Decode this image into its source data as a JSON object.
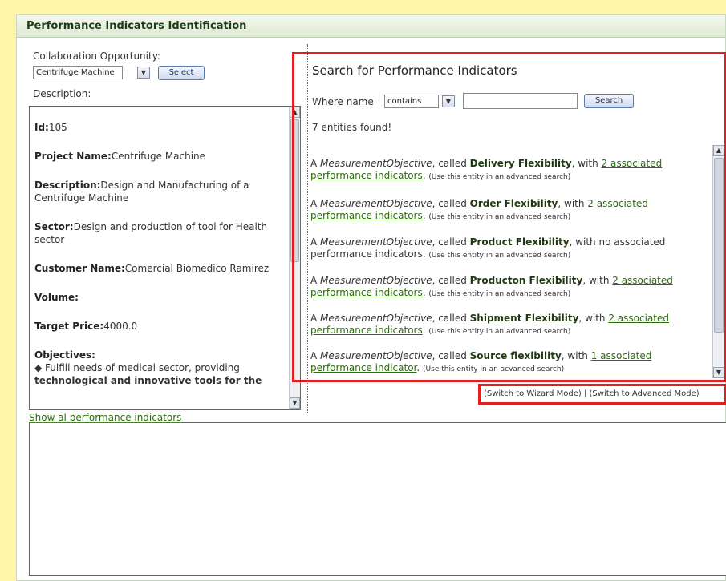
{
  "panel": {
    "title": "Performance Indicators Identification"
  },
  "left": {
    "collab_label": "Collaboration Opportunity:",
    "collab_value": "Centrifuge Machine",
    "select_button": "Select",
    "description_label": "Description:"
  },
  "description": {
    "id_label": "Id:",
    "id_value": "105",
    "project_label": "Project Name:",
    "project_value": "Centrifuge Machine",
    "desc_label": "Description:",
    "desc_value": "Design and Manufacturing of a Centrifuge Machine",
    "sector_label": "Sector:",
    "sector_value": "Design and production of tool for Health sector",
    "customer_label": "Customer Name:",
    "customer_value": "Comercial Biomedico Ramirez",
    "volume_label": "Volume:",
    "price_label": "Target Price:",
    "price_value": "4000.0",
    "objectives_label": "Objectives:",
    "objective_1": "Fulfill needs of medical sector, providing",
    "objective_2": "technological and innovative tools for the"
  },
  "search": {
    "title": "Search for Performance Indicators",
    "where_label": "Where name",
    "operator": "contains",
    "query": "",
    "button": "Search",
    "count_text": "7 entities found!"
  },
  "results": [
    {
      "prefix": "A ",
      "type": "MeasurementObjective",
      "called": ", called ",
      "name": "Delivery Flexibility",
      "mid": ", with ",
      "link": "2 associated performance indicators",
      "end": ". ",
      "hint": "(Use this entity in an advanced search)"
    },
    {
      "prefix": "A ",
      "type": "MeasurementObjective",
      "called": ", called ",
      "name": "Order Flexibility",
      "mid": ", with ",
      "link": "2 associated performance indicators",
      "end": ". ",
      "hint": "(Use this entity in an advanced search)"
    },
    {
      "prefix": "A ",
      "type": "MeasurementObjective",
      "called": ", called ",
      "name": "Product Flexibility",
      "mid": ", with no associated performance indicators",
      "link": "",
      "end": ". ",
      "hint": "(Use this entity in an advanced search)"
    },
    {
      "prefix": "A ",
      "type": "MeasurementObjective",
      "called": ", called ",
      "name": "Producton Flexibility",
      "mid": ", with ",
      "link": "2 associated performance indicators",
      "end": ". ",
      "hint": "(Use this entity in an advanced search)"
    },
    {
      "prefix": "A ",
      "type": "MeasurementObjective",
      "called": ", called ",
      "name": "Shipment Flexibility",
      "mid": ", with ",
      "link": "2 associated performance indicators",
      "end": ". ",
      "hint": "(Use this entity in an advanced search)"
    },
    {
      "prefix": "A ",
      "type": "MeasurementObjective",
      "called": ", called ",
      "name": "Source flexibility",
      "mid": ", with ",
      "link": "1 associated performance indicator",
      "end": ". ",
      "hint": "(Use this entity in an acvanced search)"
    }
  ],
  "modes": {
    "wizard": "(Switch to Wizard Mode)",
    "separator": " | ",
    "advanced": "(Switch to Advanced Mode)"
  },
  "bottom": {
    "show_all": "Show al performance indicators",
    "textarea_value": ""
  },
  "colors": {
    "highlight": "#e02020",
    "link": "#2e6b0f",
    "page_bg": "#fff6a8"
  }
}
